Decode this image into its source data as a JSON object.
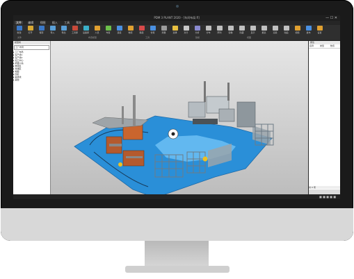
{
  "window": {
    "title": "PDM 3 PLANT  2020 - [车间布局.fl]",
    "controls": [
      "—",
      "☐",
      "✕"
    ]
  },
  "menu": [
    "文件",
    "编辑",
    "视图",
    "插入",
    "工具",
    "帮助"
  ],
  "ribbon": {
    "buttons": [
      {
        "label": "新建",
        "color": "#3a78c8"
      },
      {
        "label": "打开",
        "color": "#d8a834"
      },
      {
        "label": "保存",
        "color": "#3a78c8"
      },
      {
        "label": "导入",
        "color": "#5aa0d8"
      },
      {
        "label": "导出",
        "color": "#5aa0d8"
      },
      {
        "label": "工具库",
        "color": "#c84a3a"
      },
      {
        "label": "设备库",
        "color": "#3ab0c8"
      },
      {
        "label": "人员",
        "color": "#e0a030"
      },
      {
        "label": "布置",
        "color": "#6cc04a"
      },
      {
        "label": "连接",
        "color": "#4a90e2"
      },
      {
        "label": "物流",
        "color": "#e0a030"
      },
      {
        "label": "路径",
        "color": "#d84a4a"
      },
      {
        "label": "仿真",
        "color": "#4a90e2"
      },
      {
        "label": "测量",
        "color": "#9c9c9c"
      },
      {
        "label": "选择",
        "color": "#e8c040"
      },
      {
        "label": "对齐",
        "color": "#c8c8c8"
      },
      {
        "label": "分析",
        "color": "#8a8ad0"
      },
      {
        "label": "分布",
        "color": "#c0c0c0"
      },
      {
        "label": "阵列",
        "color": "#c0c0c0"
      },
      {
        "label": "镜像",
        "color": "#c0c0c0"
      },
      {
        "label": "隐藏",
        "color": "#c0c0c0"
      },
      {
        "label": "显示",
        "color": "#c0c0c0"
      },
      {
        "label": "报表",
        "color": "#c0c0c0"
      },
      {
        "label": "渲染",
        "color": "#c0c0c0"
      },
      {
        "label": "动画",
        "color": "#c0c0c0"
      },
      {
        "label": "视频",
        "color": "#e0a030"
      },
      {
        "label": "发布",
        "color": "#4a90e2"
      },
      {
        "label": "设置",
        "color": "#e0a030"
      }
    ],
    "groups": [
      "文件",
      "布置模型",
      "工具",
      "建模",
      "视图"
    ]
  },
  "left_panel": {
    "header": "模型树",
    "search": "工厂布局",
    "tree": [
      "▸ 工厂布局",
      "  ▸ 生产线1",
      "  ▸ 生产线2",
      "  ▸ 加工中心",
      "  ▸ 机器人站",
      "  ▸ 物流区",
      "  ▸ 仓储区",
      "  ▸ 地面",
      "  ▸ 围栏",
      "  ▸ 输送线",
      "  ▸ 其他"
    ]
  },
  "right_panel": {
    "header": "属性",
    "columns": [
      "名称",
      "类型",
      "数值"
    ],
    "footer": "共 0 项"
  },
  "colors": {
    "floor": "#2a8fd8",
    "floor_light": "#55b0ee",
    "accent": "#e0a030"
  }
}
